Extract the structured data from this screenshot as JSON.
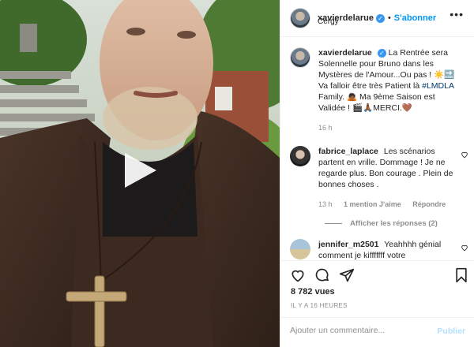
{
  "post": {
    "author": "xavierdelarue",
    "follow_label": "S'abonner",
    "separator": "•",
    "location": "Cergy",
    "more_label": "•••",
    "verified_glyph": "✓"
  },
  "caption": {
    "username": "xavierdelarue",
    "text_1": "La Rentrée sera Solennelle pour Bruno dans les Mystères de l'Amour...Ou pas ! ☀️🔜 Va falloir être très Patient là ",
    "hashtag": "#LMDLA",
    "text_2": " Family. 🙇🏾 Ma 9ème Saison est Validée ! 🎬🙏🏾MERCI.🤎",
    "time": "16 h"
  },
  "comments": [
    {
      "username": "fabrice_laplace",
      "text": "Les scénarios partent en vrille. Dommage ! Je ne regarde plus. Bon courage . Plein de bonnes choses .",
      "time": "13 h",
      "likes": "1 mention J'aime",
      "reply_label": "Répondre",
      "replies_label": "Afficher les réponses (2)"
    },
    {
      "username": "jennifer_m2501",
      "text": "Yeahhhh génial comment je kifffffff votre"
    }
  ],
  "stats": {
    "views": "8 782 vues",
    "time_ago": "IL Y A 16 HEURES"
  },
  "composer": {
    "placeholder": "Ajouter un commentaire...",
    "publish_label": "Publier"
  },
  "icons": {
    "like": "heart-icon",
    "comment": "comment-icon",
    "share": "paper-plane-icon",
    "save": "bookmark-icon",
    "play": "play-icon"
  },
  "colors": {
    "accent": "#0095f6",
    "verified": "#3897f0",
    "muted": "#8e8e8e",
    "publish_disabled": "#b2dffc"
  }
}
